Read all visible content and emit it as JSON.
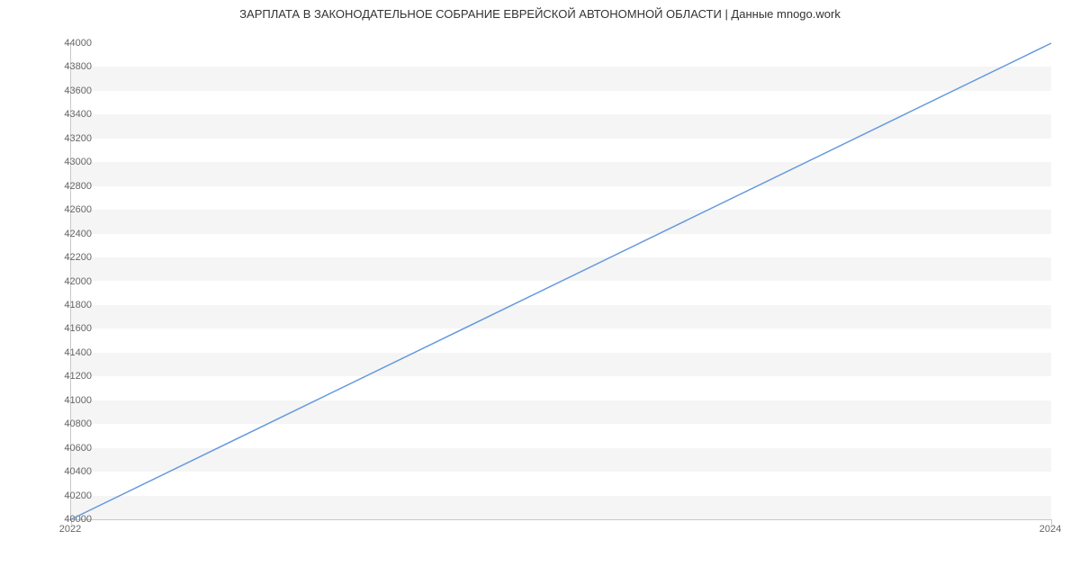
{
  "chart_data": {
    "type": "line",
    "title": "ЗАРПЛАТА В ЗАКОНОДАТЕЛЬНОЕ СОБРАНИЕ ЕВРЕЙСКОЙ АВТОНОМНОЙ ОБЛАСТИ | Данные mnogo.work",
    "x": [
      2022,
      2024
    ],
    "values": [
      40000,
      44000
    ],
    "xlabel": "",
    "ylabel": "",
    "xlim": [
      2022,
      2024
    ],
    "ylim": [
      40000,
      44000
    ],
    "x_ticks": [
      2022,
      2024
    ],
    "y_ticks": [
      40000,
      40200,
      40400,
      40600,
      40800,
      41000,
      41200,
      41400,
      41600,
      41800,
      42000,
      42200,
      42400,
      42600,
      42800,
      43000,
      43200,
      43400,
      43600,
      43800,
      44000
    ],
    "colors": {
      "line": "#6699dd",
      "grid": "#f5f5f5",
      "axis": "#c9c9c9",
      "text": "#666666"
    }
  }
}
